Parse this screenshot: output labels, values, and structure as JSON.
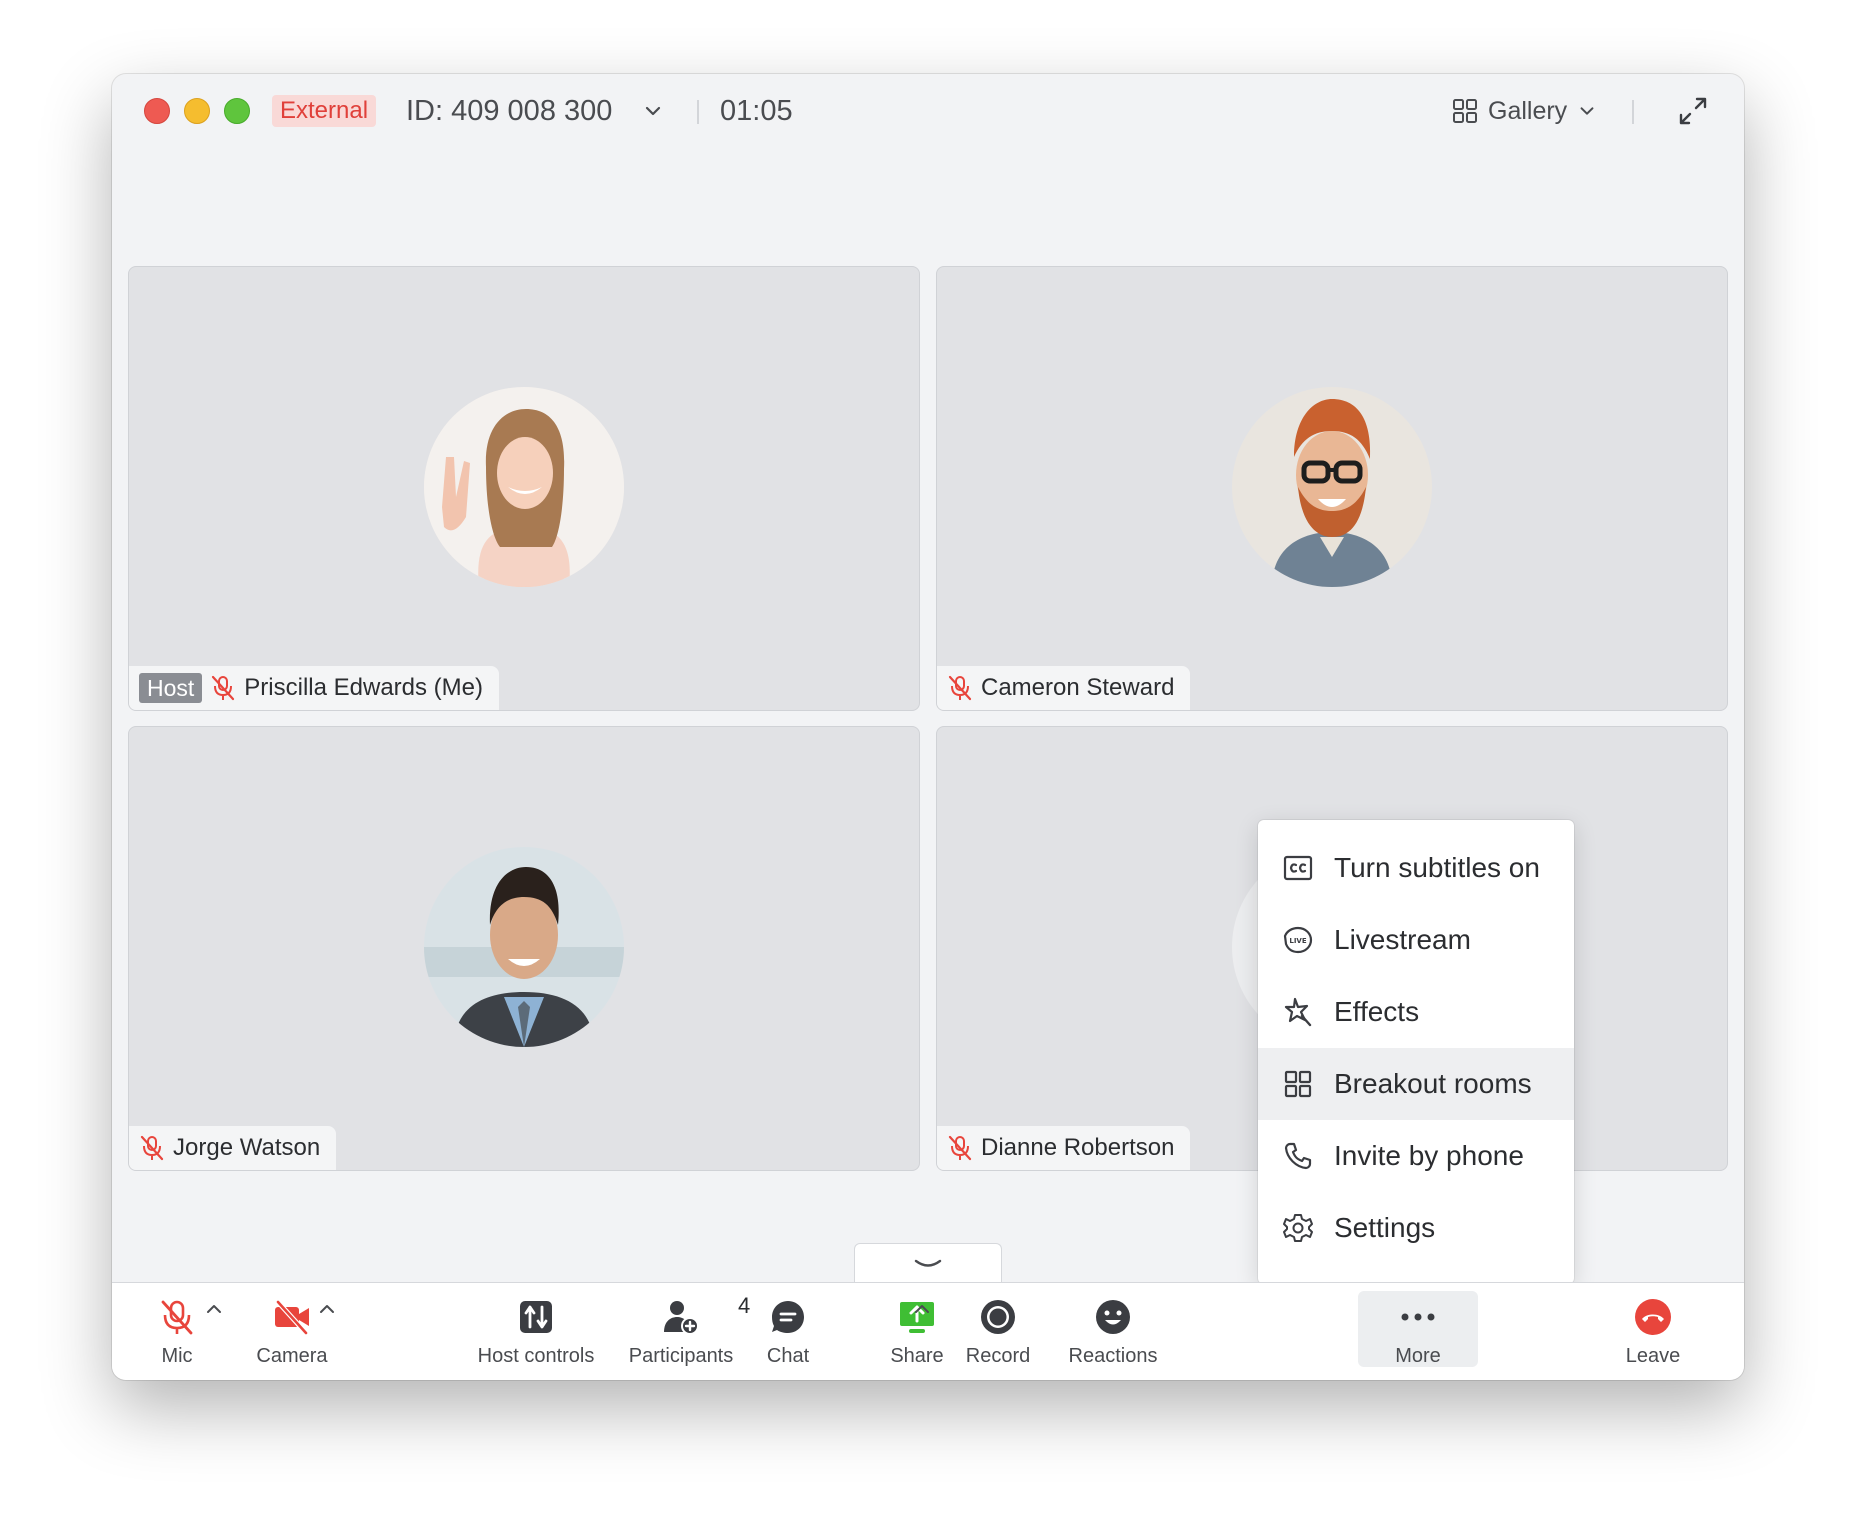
{
  "titlebar": {
    "badge": "External",
    "meeting_id": "ID: 409 008 300",
    "timer": "01:05",
    "view_label": "Gallery"
  },
  "tiles": [
    {
      "host_tag": "Host",
      "name": "Priscilla Edwards (Me)",
      "muted": true
    },
    {
      "name": "Cameron Steward",
      "muted": true
    },
    {
      "name": "Jorge Watson",
      "muted": true
    },
    {
      "name": "Dianne Robertson",
      "muted": true
    }
  ],
  "menu": {
    "items": [
      {
        "label": "Turn subtitles on",
        "icon": "subtitles-icon"
      },
      {
        "label": "Livestream",
        "icon": "livestream-icon"
      },
      {
        "label": "Effects",
        "icon": "effects-icon"
      },
      {
        "label": "Breakout rooms",
        "icon": "breakout-rooms-icon",
        "highlighted": true
      },
      {
        "label": "Invite by phone",
        "icon": "phone-icon"
      },
      {
        "label": "Settings",
        "icon": "gear-icon"
      }
    ]
  },
  "toolbar": {
    "mic": "Mic",
    "camera": "Camera",
    "host_controls": "Host controls",
    "participants": "Participants",
    "participants_count": "4",
    "chat": "Chat",
    "share": "Share",
    "record": "Record",
    "reactions": "Reactions",
    "more": "More",
    "leave": "Leave"
  },
  "colors": {
    "accent_red": "#e8453c",
    "share_green": "#3fbe34",
    "external_badge_bg": "#f9d9d7",
    "icon_dark": "#3b3d42"
  }
}
